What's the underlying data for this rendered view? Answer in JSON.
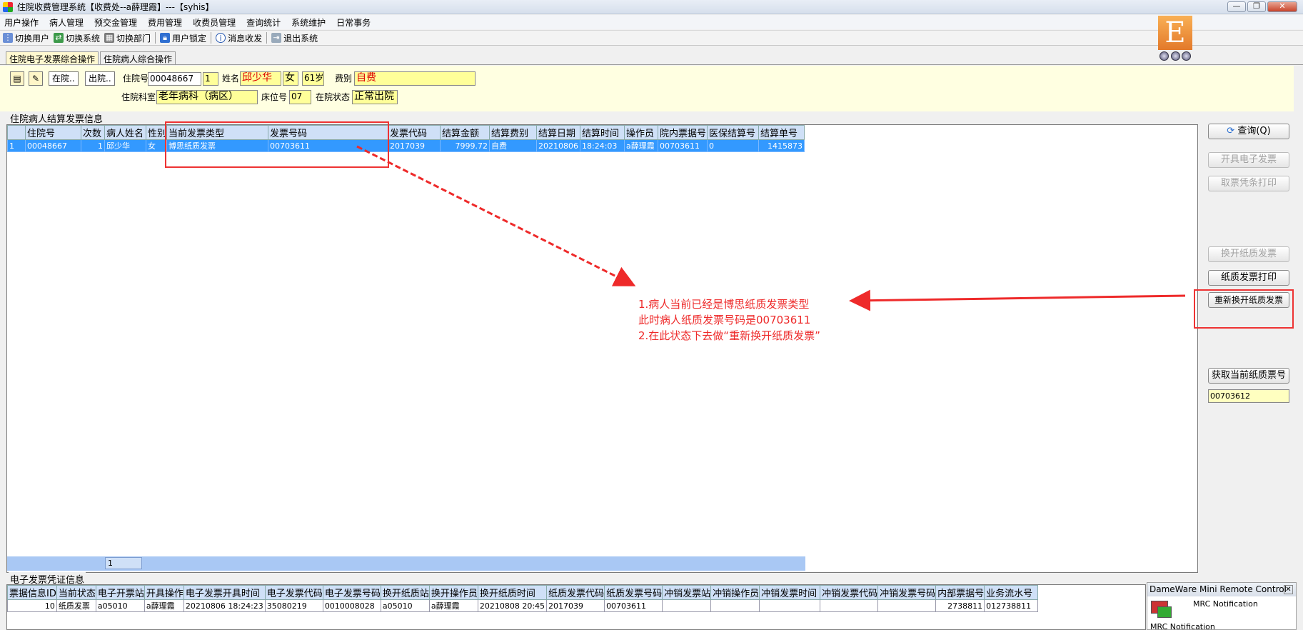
{
  "window": {
    "title": "住院收费管理系统【收费处--a薛理霞】---【syhis】",
    "buttons": [
      "—",
      "❐",
      "✕"
    ]
  },
  "menu": [
    "用户操作",
    "病人管理",
    "预交金管理",
    "费用管理",
    "收费员管理",
    "查询统计",
    "系统维护",
    "日常事务"
  ],
  "toolbar": {
    "switch_user": "切换用户",
    "switch_system": "切换系统",
    "switch_dept": "切换部门",
    "lock_user": "用户锁定",
    "messages": "消息收发",
    "exit": "退出系统"
  },
  "logo": {
    "letter": "E"
  },
  "tabs": [
    "住院电子发票综合操作",
    "住院病人综合操作"
  ],
  "patient": {
    "btn_inpatient": "在院..",
    "btn_discharged": "出院..",
    "admission_no_label": "住院号",
    "admission_no": "00048667",
    "visit_count": "1",
    "name_label": "姓名",
    "name": "邱少华",
    "gender": "女",
    "age": "61岁",
    "fee_type_label": "费别",
    "fee_type": "自费",
    "dept_label": "住院科室",
    "dept": "老年病科（病区）",
    "bed_label": "床位号",
    "bed": "07",
    "status_label": "在院状态",
    "status": "正常出院"
  },
  "settlement": {
    "group_title": "住院病人结算发票信息",
    "headers": [
      "住院号",
      "次数",
      "病人姓名",
      "性别",
      "当前发票类型",
      "发票号码",
      "发票代码",
      "结算金额",
      "结算费别",
      "结算日期",
      "结算时间",
      "操作员",
      "院内票据号",
      "医保结算号",
      "结算单号"
    ],
    "rows": [
      {
        "index": "1",
        "cells": [
          "00048667",
          "1",
          "邱少华",
          "女",
          "博思纸质发票",
          "00703611",
          "2017039",
          "7999.72",
          "自费",
          "20210806",
          "18:24:03",
          "a薛理霞",
          "00703611",
          "0",
          "1415873"
        ]
      }
    ],
    "footer_count": "1"
  },
  "e_invoice": {
    "group_title": "电子发票凭证信息",
    "headers": [
      "票据信息ID",
      "当前状态",
      "电子开票站",
      "开具操作",
      "电子发票开具时间",
      "电子发票代码",
      "电子发票号码",
      "换开纸质站",
      "换开操作员",
      "换开纸质时间",
      "纸质发票代码",
      "纸质发票号码",
      "冲销发票站",
      "冲销操作员",
      "冲销发票时间",
      "冲销发票代码",
      "冲销发票号码",
      "内部票据号",
      "业务流水号"
    ],
    "rows": [
      {
        "cells": [
          "10",
          "纸质发票",
          "a05010",
          "a薛理霞",
          "20210806 18:24:23",
          "35080219",
          "0010008028",
          "a05010",
          "a薛理霞",
          "20210808 20:45",
          "2017039",
          "00703611",
          "",
          "",
          "",
          "",
          "",
          "2738811",
          "012738811"
        ]
      }
    ]
  },
  "right_panel": {
    "query": "查询(Q)",
    "issue_e_invoice": "开具电子发票",
    "print_receipt": "取票凭条打印",
    "exchange_paper": "换开纸质发票",
    "print_paper": "纸质发票打印",
    "reexchange_paper": "重新换开纸质发票",
    "get_current_paper_no": "获取当前纸质票号",
    "current_paper_no": "00703612"
  },
  "annotation": {
    "line1": "1.病人当前已经是博思纸质发票类型",
    "line2": "此时病人纸质发票号码是00703611",
    "line3": "2.在此状态下去做“重新换开纸质发票”",
    "color": "#ee2a2a"
  },
  "dameware": {
    "title": "DameWare Mini Remote Control",
    "close": "✕",
    "line1": "MRC Notification",
    "line2": "MRC Notification"
  }
}
